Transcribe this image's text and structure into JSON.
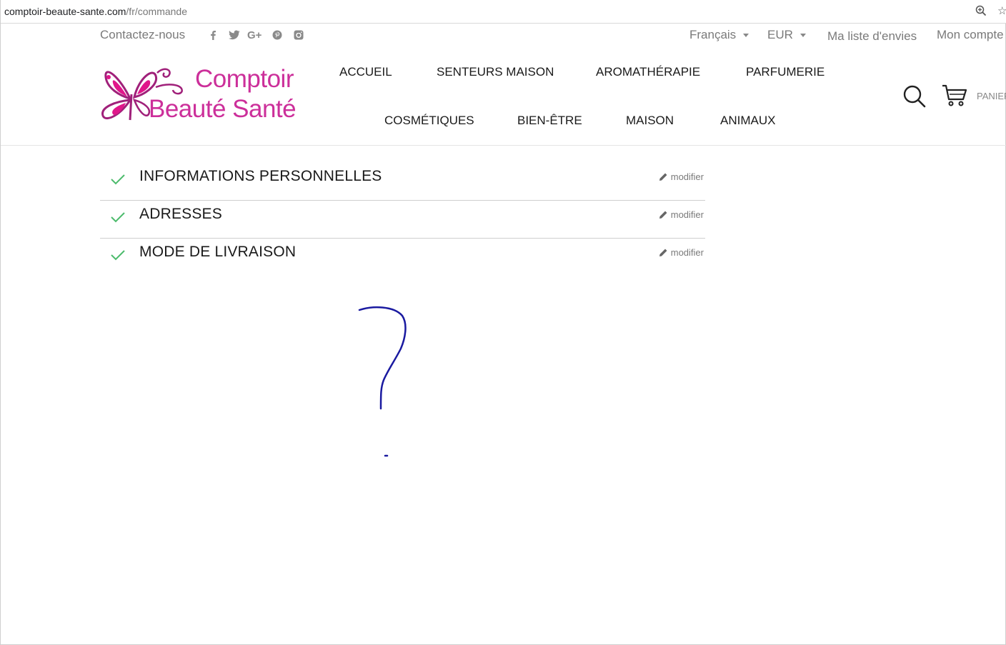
{
  "browser": {
    "url_domain": "comptoir-beaute-sante.com",
    "url_path": "/fr/commande",
    "icons": [
      "zoom-icon",
      "star-icon"
    ]
  },
  "topbar": {
    "contact": "Contactez-nous",
    "social_icons": [
      "facebook-icon",
      "twitter-icon",
      "google-plus-icon",
      "pinterest-icon",
      "instagram-icon"
    ],
    "language": "Français",
    "currency": "EUR",
    "wishlist": "Ma liste d'envies",
    "account": "Mon compte"
  },
  "logo": {
    "line1": "Comptoir",
    "line2": "Beauté Santé",
    "color": "#cc2f9a"
  },
  "nav": {
    "row1": [
      "ACCUEIL",
      "SENTEURS MAISON",
      "AROMATHÉRAPIE",
      "PARFUMERIE"
    ],
    "row2": [
      "COSMÉTIQUES",
      "BIEN-ÊTRE",
      "MAISON",
      "ANIMAUX"
    ]
  },
  "cart": {
    "label": "PANIER"
  },
  "checkout": {
    "steps": [
      {
        "title": "INFORMATIONS PERSONNELLES",
        "edit": "modifier",
        "complete": true
      },
      {
        "title": "ADRESSES",
        "edit": "modifier",
        "complete": true
      },
      {
        "title": "MODE DE LIVRAISON",
        "edit": "modifier",
        "complete": true
      }
    ],
    "check_color": "#4cbb6c"
  },
  "annotation": {
    "icon": "question-mark-scribble",
    "color": "#1a1aa0"
  }
}
